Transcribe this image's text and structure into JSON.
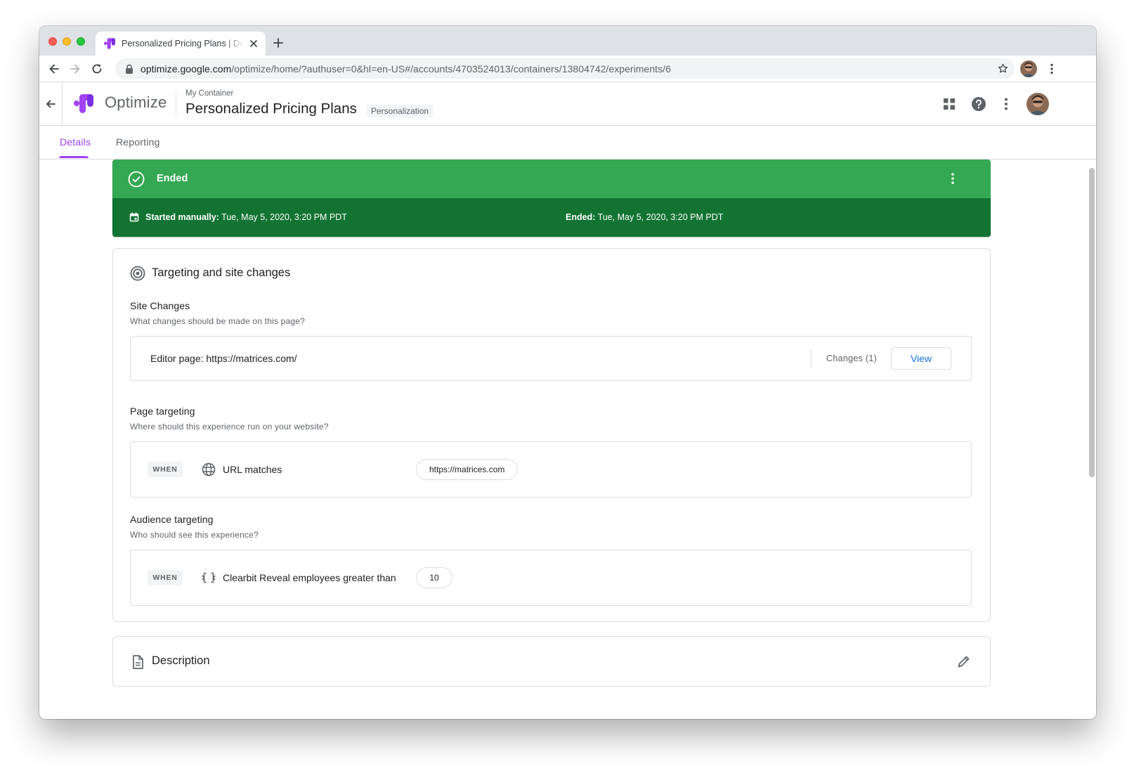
{
  "browser": {
    "tab_title": "Personalized Pricing Plans | Details",
    "url_host": "optimize.google.com",
    "url_path": "/optimize/home/?authuser=0&hl=en-US#/accounts/4703524013/containers/13804742/experiments/6"
  },
  "header": {
    "product": "Optimize",
    "container": "My Container",
    "experience_name": "Personalized Pricing Plans",
    "experience_type": "Personalization"
  },
  "subtabs": [
    {
      "label": "Details",
      "active": true
    },
    {
      "label": "Reporting",
      "active": false
    }
  ],
  "status": {
    "label": "Ended",
    "started_label": "Started manually:",
    "started_value": "Tue, May 5, 2020, 3:20 PM PDT",
    "ended_label": "Ended:",
    "ended_value": "Tue, May 5, 2020, 3:20 PM PDT"
  },
  "targeting": {
    "title": "Targeting and site changes",
    "site_changes": {
      "title": "Site Changes",
      "subtitle": "What changes should be made on this page?",
      "editor_page": "Editor page: https://matrices.com/",
      "changes": "Changes (1)",
      "view_label": "View"
    },
    "page_targeting": {
      "title": "Page targeting",
      "subtitle": "Where should this experience run on your website?",
      "when": "WHEN",
      "rule": "URL matches",
      "value": "https://matrices.com"
    },
    "audience_targeting": {
      "title": "Audience targeting",
      "subtitle": "Who should see this experience?",
      "when": "WHEN",
      "rule": "Clearbit Reveal employees greater than",
      "value": "10"
    }
  },
  "description": {
    "title": "Description"
  },
  "colors": {
    "accent": "#a142f4",
    "status_green": "#34a853",
    "status_dark_green": "#137333",
    "link_blue": "#1a73e8"
  },
  "icons": {
    "status": "check-circle-icon",
    "targeting": "target-icon",
    "page_rule": "globe-icon",
    "audience_rule": "api-icon",
    "description": "document-icon",
    "edit": "pencil-icon"
  }
}
